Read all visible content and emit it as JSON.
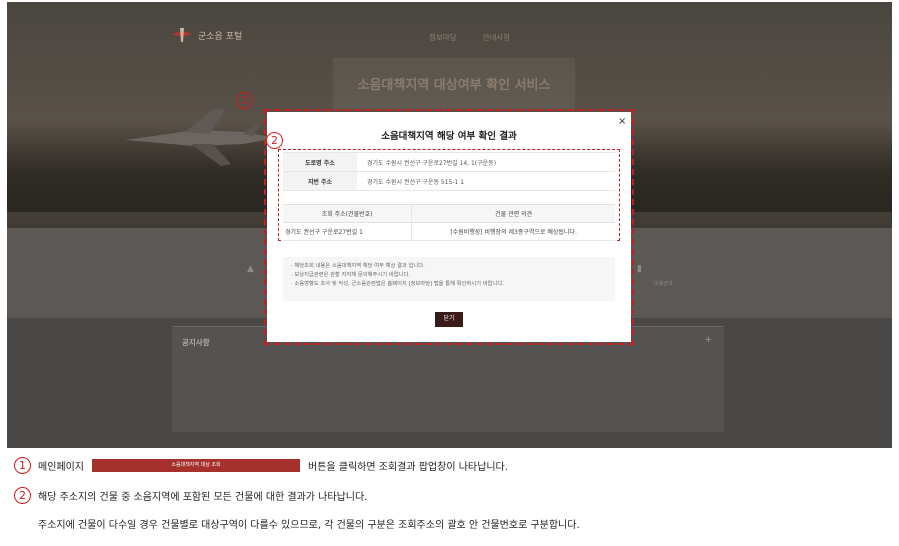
{
  "portal": {
    "logo_text": "군소음 포털",
    "nav": [
      "정보마당",
      "안내사항"
    ],
    "hero_title": "소음대책지역 대상여부 확인 서비스",
    "notice_title": "공지사항",
    "notice_plus": "+",
    "band_left_text": "...",
    "band_right_text": "이용안내"
  },
  "markers": {
    "one": "1",
    "two": "2"
  },
  "modal": {
    "title": "소음대책지역 해당 여부 확인 결과",
    "close_symbol": "×",
    "road_label": "도로명 주소",
    "road_value": "경기도 수원시 권선구 구운로27번길 14, 1(구운동)",
    "lot_label": "지번 주소",
    "lot_value": "경기도 수원시 권선구 구운동 515-1 1",
    "col_headers": [
      "조회 주소(건물번호)",
      "건물 관련 의견"
    ],
    "row": [
      "경기도 권선구 구운로27번길 1",
      "[수원비행장] 비행장의 제3종구역으로 예상됩니다."
    ],
    "info_lines": [
      "· 해당조회 내용은 소음대책지역 해당 여부 예상 결과 입니다.",
      "· 보상지급관련은 관할 지자체 문의해주시기 바랍니다.",
      "· 소음영향도 조사 및 작성, 군소음관련법은 홈페이지 [정보마당] 탭을 통해 확인하시기 바랍니다."
    ],
    "close_button": "닫기"
  },
  "captions": {
    "c1_prefix": "메인페이지",
    "c1_button": "소음대책지역 대상 조회",
    "c1_suffix": "버튼을 클릭하면 조회결과 팝업창이 나타납니다.",
    "c2": "해당 주소지의 건물 중 소음지역에 포함된 모든 건물에 대한 결과가 나타납니다.",
    "c3": "주소지에 건물이 다수일 경우 건물별로 대상구역이 다를수 있으므로, 각 건물의 구분은 조회주소의 괄호 안 건물번호로 구분합니다."
  },
  "colors": {
    "accent_red": "#c81e1e",
    "button_dark": "#3b1a1a",
    "inline_button": "#a5302c"
  }
}
